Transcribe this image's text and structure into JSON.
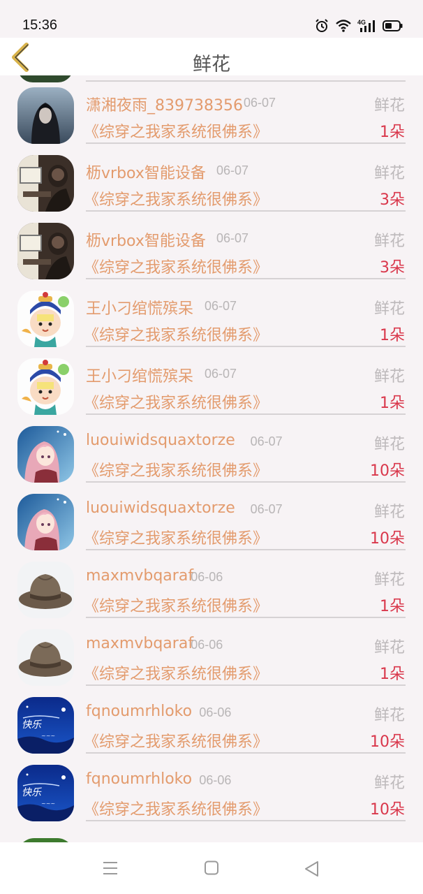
{
  "status_bar": {
    "time": "15:36",
    "network": "4G"
  },
  "header": {
    "title": "鲜花",
    "back_icon": "chevron-left-icon"
  },
  "colors": {
    "name": "#e39b6d",
    "count": "#d9374b",
    "muted": "#bdb9bb",
    "back_arrow": "#d8b24a"
  },
  "items": [
    {
      "name": "潇湘夜雨_839738356",
      "date": "06-07",
      "type": "鲜花",
      "book": "《综穿之我家系统很佛系》",
      "count": "1朵",
      "avatar": "hooded-figure"
    },
    {
      "name": "枥vrbox智能设备",
      "date": "06-07",
      "type": "鲜花",
      "book": "《综穿之我家系统很佛系》",
      "count": "3朵",
      "avatar": "computer-desk"
    },
    {
      "name": "枥vrbox智能设备",
      "date": "06-07",
      "type": "鲜花",
      "book": "《综穿之我家系统很佛系》",
      "count": "3朵",
      "avatar": "computer-desk"
    },
    {
      "name": "王小刁绾慌殡呆",
      "date": "06-07",
      "type": "鲜花",
      "book": "《综穿之我家系统很佛系》",
      "count": "1朵",
      "avatar": "cartoon-official"
    },
    {
      "name": "王小刁绾慌殡呆",
      "date": "06-07",
      "type": "鲜花",
      "book": "《综穿之我家系统很佛系》",
      "count": "1朵",
      "avatar": "cartoon-official"
    },
    {
      "name": "luouiwidsquaxtorze",
      "date": "06-07",
      "type": "鲜花",
      "book": "《综穿之我家系统很佛系》",
      "count": "10朵",
      "avatar": "anime-girl"
    },
    {
      "name": "luouiwidsquaxtorze",
      "date": "06-07",
      "type": "鲜花",
      "book": "《综穿之我家系统很佛系》",
      "count": "10朵",
      "avatar": "anime-girl"
    },
    {
      "name": "maxmvbqaraf",
      "date": "06-06",
      "type": "鲜花",
      "book": "《综穿之我家系统很佛系》",
      "count": "1朵",
      "avatar": "brown-hat"
    },
    {
      "name": "maxmvbqaraf",
      "date": "06-06",
      "type": "鲜花",
      "book": "《综穿之我家系统很佛系》",
      "count": "1朵",
      "avatar": "brown-hat"
    },
    {
      "name": "fqnoumrhloko",
      "date": "06-06",
      "type": "鲜花",
      "book": "《综穿之我家系统很佛系》",
      "count": "10朵",
      "avatar": "holiday-card"
    },
    {
      "name": "fqnoumrhloko",
      "date": "06-06",
      "type": "鲜花",
      "book": "《综穿之我家系统很佛系》",
      "count": "10朵",
      "avatar": "holiday-card"
    }
  ],
  "nav": {
    "menu_icon": "menu-icon",
    "home_icon": "home-square-icon",
    "back_icon": "back-triangle-icon"
  }
}
